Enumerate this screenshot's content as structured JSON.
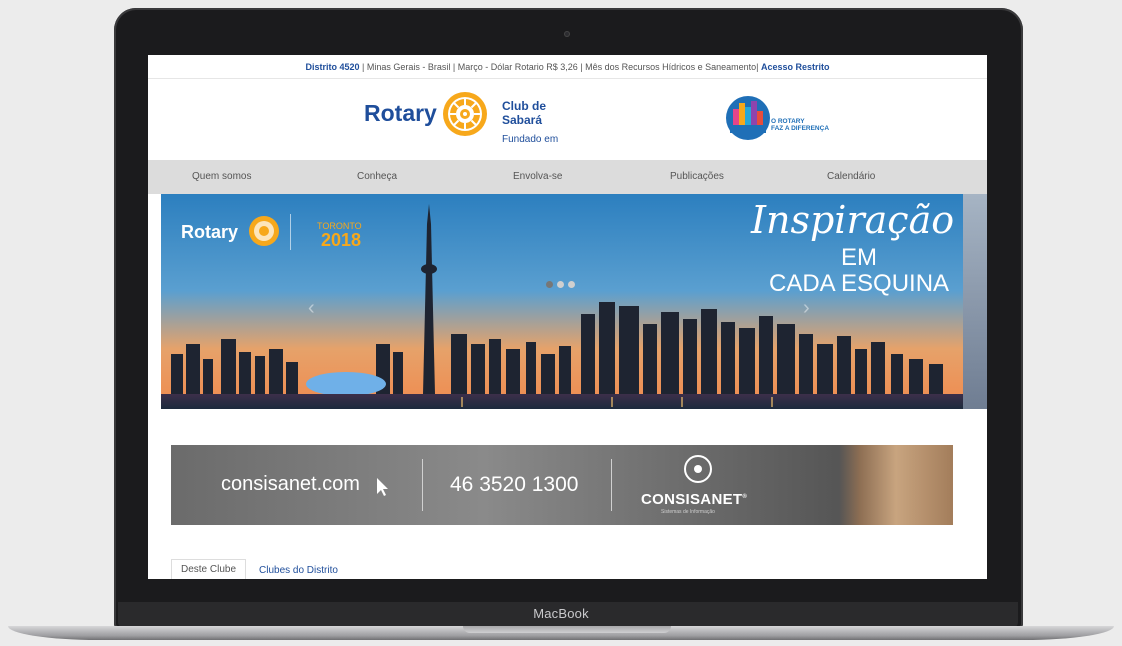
{
  "device": {
    "label": "MacBook"
  },
  "topbar": {
    "district": "Distrito 4520",
    "sep1": " | Minas Gerais - Brasil | Março - Dólar Rotario R$ 3,26 | Mês dos Recursos Hídricos e Saneamento| ",
    "restricted": "Acesso Restrito"
  },
  "header": {
    "rotary_word": "Rotary",
    "club_line1": "Club de",
    "club_line2": "Sabará",
    "founded": "Fundado em",
    "theme_line1": "O ROTARY",
    "theme_line2": "FAZ A DIFERENÇA"
  },
  "nav": {
    "items": [
      "Quem somos",
      "Conheça",
      "Envolva-se",
      "Publicações",
      "Calendário"
    ]
  },
  "slider": {
    "rotary_word": "Rotary",
    "city_word": "TORONTO",
    "year": "2018",
    "headline_script": "Inspiração",
    "headline_line2": "EM",
    "headline_line3": "CADA ESQUINA",
    "dots": 3,
    "active_dot": 0
  },
  "ad": {
    "site": "consisanet.com",
    "phone": "46 3520 1300",
    "brand": "CONSISANET",
    "brand_tm": "®",
    "brand_sub": "Sistemas de Informação"
  },
  "tabs": {
    "tab1": "Deste Clube",
    "tab2": "Clubes do Distrito"
  },
  "colors": {
    "rotary_blue": "#1f4e9b",
    "rotary_gold": "#f7a81b",
    "nav_bg": "#dcdcdc"
  }
}
